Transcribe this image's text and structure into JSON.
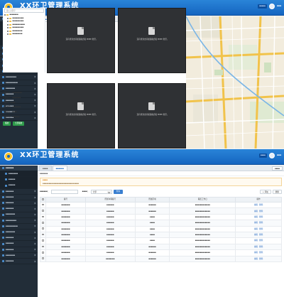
{
  "app": {
    "title": "XX环卫管理系统",
    "top_buttons": [
      "▪▪▪▪▪",
      "▪▪▪▪"
    ],
    "user": "▪▪▪"
  },
  "sidebar": {
    "header": "▪▪▪▪▪▪",
    "items1": [
      {
        "label": "▪▪▪▪▪▪▪",
        "sub": true
      },
      {
        "label": "▪▪▪▪▪",
        "sub": true
      },
      {
        "label": "▪▪▪▪▪▪▪▪",
        "sub": true
      },
      {
        "label": "▪▪▪▪▪▪",
        "sub": true
      },
      {
        "label": "▪▪▪▪▪▪",
        "sub": false
      },
      {
        "label": "▪▪▪▪▪▪",
        "sub": false
      },
      {
        "label": "▪▪▪▪▪▪",
        "sub": false
      },
      {
        "label": "▪▪▪▪▪▪",
        "sub": false
      },
      {
        "label": "▪▪▪▪▪▪▪",
        "sub": false
      },
      {
        "label": "▪▪▪▪▪▪▪▪",
        "sub": false
      },
      {
        "label": "▪▪▪▪▪▪▪▪▪",
        "sub": false
      },
      {
        "label": "▪▪▪▪▪▪▪",
        "sub": false
      },
      {
        "label": "▪▪▪▪▪▪",
        "sub": false
      },
      {
        "label": "▪▪▪▪▪▪",
        "sub": false
      },
      {
        "label": "▪▪▪▪▪▪",
        "sub": false
      },
      {
        "label": "▪▪▪▪▪▪▪",
        "sub": false
      },
      {
        "label": "▪▪▪▪▪▪",
        "sub": false
      }
    ],
    "items2": [
      {
        "label": "▪▪▪▪▪▪▪",
        "sub": true
      },
      {
        "label": "▪▪▪▪▪",
        "sub": true
      },
      {
        "label": "▪▪▪▪▪",
        "sub": true
      },
      {
        "label": "▪▪▪▪▪▪",
        "sub": false
      },
      {
        "label": "▪▪▪▪▪▪",
        "sub": false
      },
      {
        "label": "▪▪▪▪▪▪",
        "sub": false
      },
      {
        "label": "▪▪▪▪▪▪",
        "sub": false
      },
      {
        "label": "▪▪▪▪▪▪▪",
        "sub": false
      },
      {
        "label": "▪▪▪▪▪▪▪▪",
        "sub": false
      },
      {
        "label": "▪▪▪▪▪▪▪▪▪",
        "sub": false
      },
      {
        "label": "▪▪▪▪▪▪▪",
        "sub": false
      },
      {
        "label": "▪▪▪▪▪▪",
        "sub": false
      },
      {
        "label": "▪▪▪▪▪▪",
        "sub": false
      },
      {
        "label": "▪▪▪▪▪▪",
        "sub": false
      },
      {
        "label": "▪▪▪▪▪▪▪",
        "sub": false
      },
      {
        "label": "▪▪▪▪▪▪",
        "sub": false
      }
    ]
  },
  "screen1": {
    "tabs": [
      "▪▪▪▪"
    ],
    "search_placeholder": "输入关键字",
    "tree": [
      "▪▪▪▪▪▪▪",
      "▪▪▪▪▪▪▪▪▪",
      "▪▪▪▪▪▪▪▪▪",
      "▪▪▪▪▪▪▪▪▪▪",
      "▪▪▪▪▪▪▪▪▪",
      "▪▪▪▪▪▪▪▪",
      "▪▪▪▪▪▪▪▪"
    ],
    "video_msg": "没有找到支持视频格式和 MIME 类型。",
    "info": [
      "视频编号：▪▪▪▪▪▪▪▪",
      "车辆编号：▪▪▪▪▪▪▪",
      "驾驶员：▪▪▪▪",
      "联系电话：▪▪▪▪▪▪▪",
      "车辆类型：▪▪▪▪",
      "所属单位：▪▪▪▪▪▪"
    ],
    "btn_play": "播放",
    "btn_all": "全部播放"
  },
  "screen2": {
    "tabs": [
      "▪▪▪▪",
      "▪▪▪▪▪▪"
    ],
    "tab_end": "▪▪▪▪",
    "breadcrumb": "▪▪▪▪▪▪",
    "hint_title": "▪▪▪▪",
    "hint_text": "▪▪▪▪▪▪▪▪▪▪▪▪▪▪▪▪▪▪▪▪▪▪▪▪▪▪▪▪▪",
    "search_label": "▪▪▪▪▪▪：",
    "select_label": "▪▪▪▪：",
    "select_value": "全部",
    "query_btn": "查询",
    "add_btn": "+ 添加",
    "del_btn": "删除",
    "columns": [
      "",
      "编号",
      "所属车辆编号",
      "所属区域",
      "覆盖工作日",
      "操作"
    ],
    "rows": [
      [
        "▪▪▪▪▪▪▪",
        "▪▪▪▪▪▪",
        "▪▪▪▪▪▪",
        "▪▪▪▪▪▪▪▪▪▪▪▪",
        "编辑",
        "删除"
      ],
      [
        "▪▪▪▪▪▪▪",
        "▪▪▪▪▪▪",
        "▪▪▪▪▪▪",
        "▪▪▪▪▪▪▪▪▪▪▪▪",
        "编辑",
        "删除"
      ],
      [
        "▪▪▪▪▪▪▪",
        "▪▪▪▪▪▪",
        "▪▪▪▪",
        "▪▪▪▪▪▪▪▪▪▪▪▪",
        "编辑",
        "删除"
      ],
      [
        "▪▪▪▪▪▪▪",
        "▪▪▪▪▪▪",
        "▪▪▪▪",
        "▪▪▪▪▪▪▪▪▪▪▪▪",
        "编辑",
        "删除"
      ],
      [
        "▪▪▪▪▪▪▪",
        "▪▪▪▪▪▪",
        "▪▪▪▪",
        "▪▪▪▪▪▪▪▪▪▪▪▪",
        "编辑",
        "删除"
      ],
      [
        "▪▪▪▪▪▪▪",
        "▪▪▪▪▪▪",
        "▪▪▪▪",
        "▪▪▪▪▪▪▪▪▪▪▪▪",
        "编辑",
        "删除"
      ],
      [
        "▪▪▪▪▪▪▪",
        "▪▪▪▪▪▪",
        "▪▪▪▪",
        "▪▪▪▪▪▪▪▪▪▪▪▪",
        "编辑",
        "删除"
      ],
      [
        "▪▪▪▪▪▪▪",
        "▪▪▪▪▪▪",
        "▪▪▪▪▪▪",
        "▪▪▪▪▪▪▪▪▪▪▪▪",
        "编辑",
        "删除"
      ],
      [
        "▪▪▪▪▪▪▪",
        "▪▪▪▪▪▪",
        "▪▪▪▪▪▪",
        "▪▪▪▪▪▪▪▪▪▪▪▪",
        "编辑",
        "删除"
      ],
      [
        "▪▪▪▪▪▪▪",
        "▪▪▪▪▪▪▪",
        "▪▪▪▪▪▪",
        "▪▪▪▪▪▪▪▪▪▪▪▪",
        "编辑",
        "删除"
      ]
    ]
  },
  "colors": {
    "topbar": "#1565c0",
    "sidebar": "#222d38",
    "accent": "#3a7fd0",
    "play_btn": "#2e9b4a",
    "map_road": "#f1c34b"
  }
}
